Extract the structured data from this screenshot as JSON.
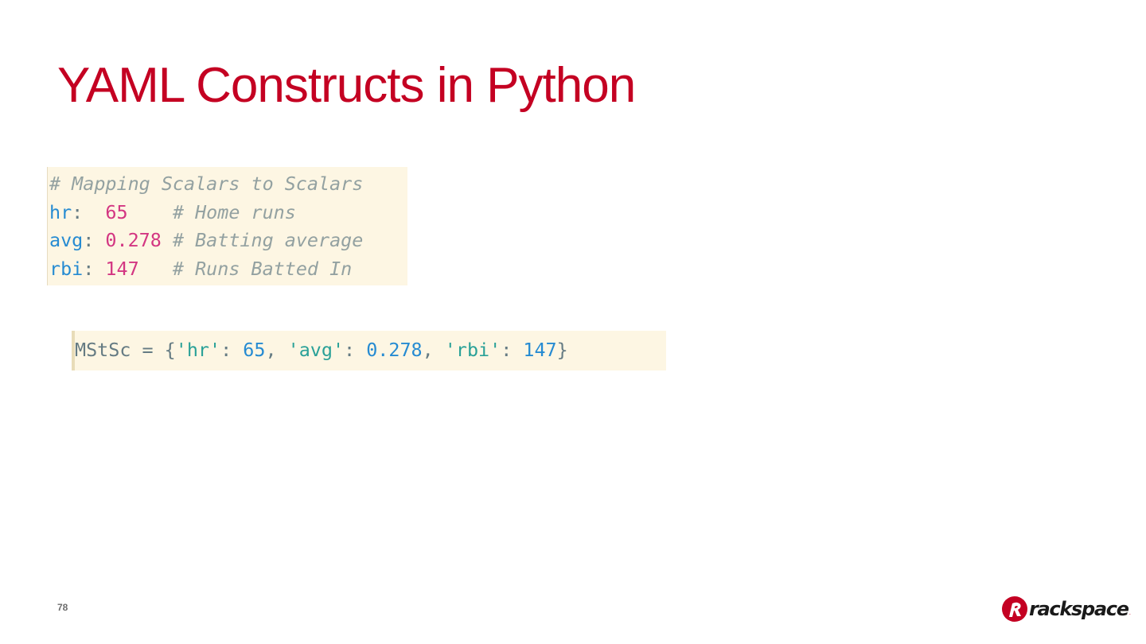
{
  "slide": {
    "title": "YAML Constructs in Python",
    "page_number": "78"
  },
  "colors": {
    "title": "#c40022",
    "code_bg": "#fdf6e3",
    "comment": "#93a1a1",
    "key": "#268bd2",
    "number_yaml": "#d33682",
    "plain": "#657b83",
    "string": "#2aa198",
    "number_py": "#268bd2"
  },
  "yaml_code": {
    "lines": [
      [
        {
          "text": "# Mapping Scalars to Scalars",
          "kind": "comment"
        }
      ],
      [
        {
          "text": "hr",
          "kind": "key"
        },
        {
          "text": ":  ",
          "kind": "plain"
        },
        {
          "text": "65",
          "kind": "number_yaml"
        },
        {
          "text": "    ",
          "kind": "plain"
        },
        {
          "text": "# Home runs",
          "kind": "comment"
        }
      ],
      [
        {
          "text": "avg",
          "kind": "key"
        },
        {
          "text": ": ",
          "kind": "plain"
        },
        {
          "text": "0.278",
          "kind": "number_yaml"
        },
        {
          "text": " ",
          "kind": "plain"
        },
        {
          "text": "# Batting average",
          "kind": "comment"
        }
      ],
      [
        {
          "text": "rbi",
          "kind": "key"
        },
        {
          "text": ": ",
          "kind": "plain"
        },
        {
          "text": "147",
          "kind": "number_yaml"
        },
        {
          "text": "   ",
          "kind": "plain"
        },
        {
          "text": "# Runs Batted In",
          "kind": "comment"
        }
      ]
    ]
  },
  "python_code": {
    "lines": [
      [
        {
          "text": "MStSc = {",
          "kind": "plain"
        },
        {
          "text": "'hr'",
          "kind": "string"
        },
        {
          "text": ": ",
          "kind": "plain"
        },
        {
          "text": "65",
          "kind": "number_py"
        },
        {
          "text": ", ",
          "kind": "plain"
        },
        {
          "text": "'avg'",
          "kind": "string"
        },
        {
          "text": ": ",
          "kind": "plain"
        },
        {
          "text": "0.278",
          "kind": "number_py"
        },
        {
          "text": ", ",
          "kind": "plain"
        },
        {
          "text": "'rbi'",
          "kind": "string"
        },
        {
          "text": ": ",
          "kind": "plain"
        },
        {
          "text": "147",
          "kind": "number_py"
        },
        {
          "text": "}",
          "kind": "plain"
        }
      ]
    ]
  },
  "logo": {
    "text": "rackspace",
    "tm": "."
  }
}
